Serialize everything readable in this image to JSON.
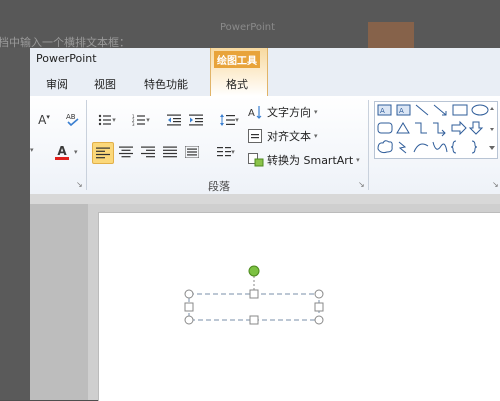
{
  "background": {
    "instruction_text": "档中输入一个横排文本框：",
    "app_name_faded": "PowerPoint"
  },
  "window": {
    "title": "PowerPoint"
  },
  "tabs": {
    "review": "审阅",
    "view": "视图",
    "special": "特色功能",
    "context_group": "绘图工具",
    "format": "格式"
  },
  "ribbon": {
    "paragraph_group_label": "段落",
    "text_direction_label": "文字方向",
    "align_text_label": "对齐文本",
    "smartart_label": "转换为 SmartArt"
  },
  "colors": {
    "accent_context": "#e8a33a",
    "active_button": "#fbd87a",
    "selection_handle": "#7cc142",
    "font_color_bar": "#e0201c"
  },
  "icons": [
    "font-size-decrease-icon",
    "spellcheck-icon",
    "bullets-icon",
    "numbering-icon",
    "decrease-indent-icon",
    "increase-indent-icon",
    "line-spacing-icon",
    "text-direction-icon",
    "align-text-icon",
    "smartart-icon",
    "align-left-icon",
    "align-center-icon",
    "align-right-icon",
    "justify-icon",
    "distributed-icon",
    "columns-icon",
    "font-color-icon",
    "shapes-gallery"
  ]
}
